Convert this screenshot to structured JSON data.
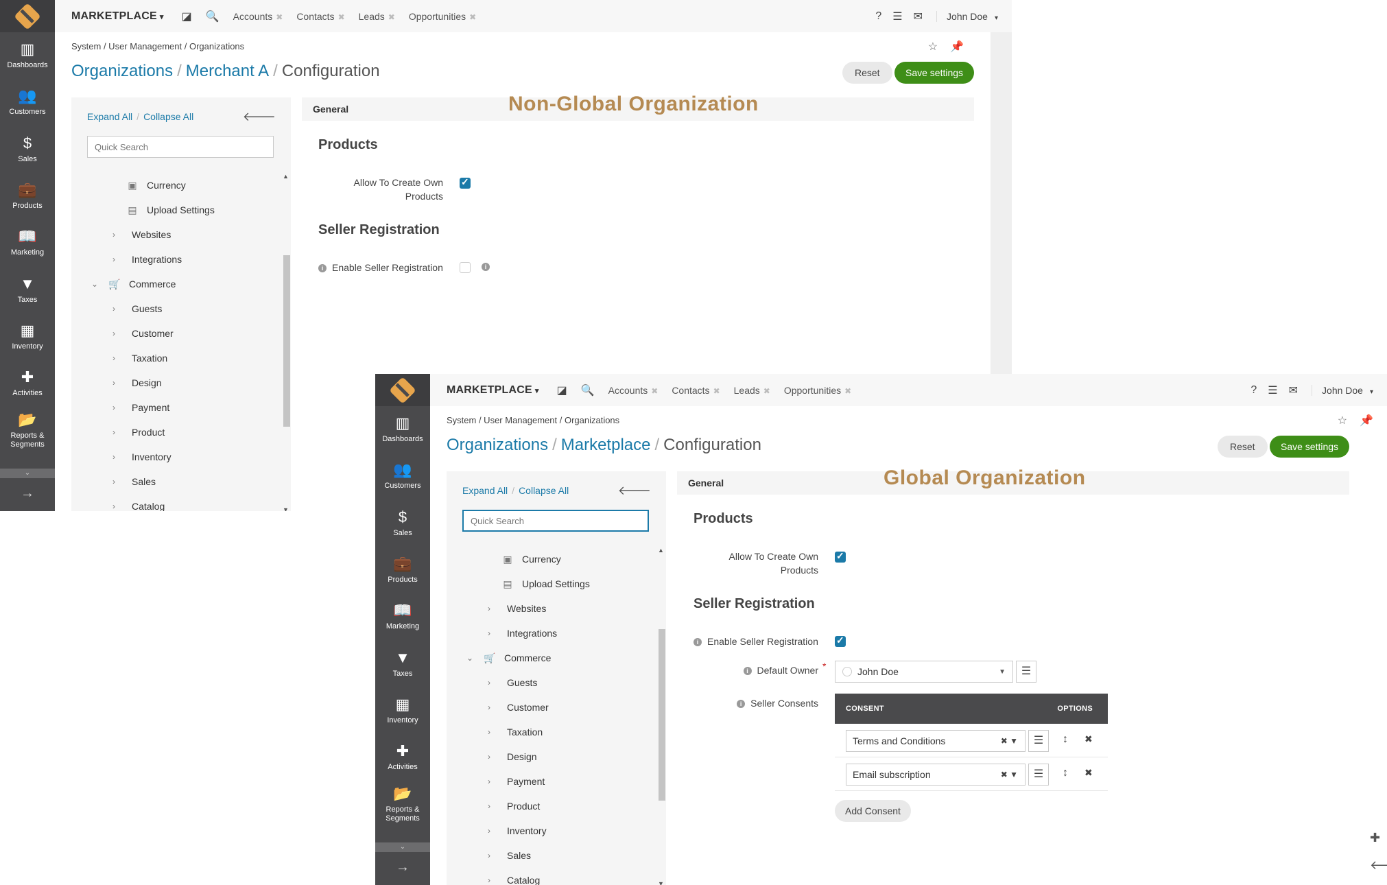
{
  "sidebar": {
    "items": [
      {
        "label": "Dashboards",
        "icon": "dashboards-icon",
        "glyph": "▥"
      },
      {
        "label": "Customers",
        "icon": "customers-icon",
        "glyph": "👥"
      },
      {
        "label": "Sales",
        "icon": "sales-icon",
        "glyph": "$"
      },
      {
        "label": "Products",
        "icon": "products-icon",
        "glyph": "💼"
      },
      {
        "label": "Marketing",
        "icon": "marketing-icon",
        "glyph": "📖"
      },
      {
        "label": "Taxes",
        "icon": "taxes-icon",
        "glyph": "▼"
      },
      {
        "label": "Inventory",
        "icon": "inventory-icon",
        "glyph": "▦"
      },
      {
        "label": "Activities",
        "icon": "activities-icon",
        "glyph": "✚"
      },
      {
        "label": "Reports & Segments",
        "icon": "reports-icon",
        "glyph": "📂"
      }
    ],
    "collapse_glyph": "⌄",
    "expand_glyph": "→"
  },
  "header": {
    "brand": "MARKETPLACE",
    "caret": "▾",
    "pinned_tabs": [
      "Accounts",
      "Contacts",
      "Leads",
      "Opportunities"
    ],
    "close_glyph": "✖",
    "user": "John Doe",
    "help_glyph": "?",
    "list_glyph": "☰",
    "mail_glyph": "✉",
    "history_glyph": "◪",
    "search_glyph": "🔍"
  },
  "breadcrumb": "System / User Management / Organizations",
  "page_icons": {
    "star": "☆",
    "pin": "📌"
  },
  "buttons": {
    "reset": "Reset",
    "save": "Save settings",
    "add_consent": "Add Consent"
  },
  "tree": {
    "expand_all": "Expand All",
    "collapse_all": "Collapse All",
    "separator": "/",
    "back_glyph": "🡐",
    "search_placeholder": "Quick Search",
    "items": [
      {
        "label": "Currency",
        "glyph": "▣",
        "level": 2
      },
      {
        "label": "Upload Settings",
        "glyph": "▤",
        "level": 2
      },
      {
        "label": "Websites",
        "glyph": "›",
        "level": 1
      },
      {
        "label": "Integrations",
        "glyph": "›",
        "level": 1
      },
      {
        "label": "Commerce",
        "glyph": "⌄",
        "level": 0,
        "cart": "🛒"
      },
      {
        "label": "Guests",
        "glyph": "›",
        "level": 1
      },
      {
        "label": "Customer",
        "glyph": "›",
        "level": 1
      },
      {
        "label": "Taxation",
        "glyph": "›",
        "level": 1
      },
      {
        "label": "Design",
        "glyph": "›",
        "level": 1
      },
      {
        "label": "Payment",
        "glyph": "›",
        "level": 1
      },
      {
        "label": "Product",
        "glyph": "›",
        "level": 1
      },
      {
        "label": "Inventory",
        "glyph": "›",
        "level": 1
      },
      {
        "label": "Sales",
        "glyph": "›",
        "level": 1
      },
      {
        "label": "Catalog",
        "glyph": "›",
        "level": 1
      }
    ]
  },
  "section": {
    "bar_label": "General",
    "products_heading": "Products",
    "allow_label_1": "Allow To Create Own",
    "allow_label_2": "Products",
    "seller_heading": "Seller Registration",
    "enable_label": "Enable Seller Registration",
    "owner_label": "Default Owner",
    "required_mark": "*",
    "consents_label": "Seller Consents"
  },
  "screens": [
    {
      "title_org": "Organizations",
      "title_entity": "Merchant A",
      "title_page": "Configuration",
      "title_sep": "/",
      "watermark": "Non-Global Organization",
      "allow_checked": true,
      "enable_checked": false
    },
    {
      "title_org": "Organizations",
      "title_entity": "Marketplace",
      "title_page": "Configuration",
      "title_sep": "/",
      "watermark": "Global Organization",
      "allow_checked": true,
      "enable_checked": true,
      "owner_value": "John Doe",
      "consent_head": "CONSENT",
      "options_head": "OPTIONS",
      "consents": [
        "Terms and Conditions",
        "Email subscription"
      ]
    }
  ],
  "colors": {
    "accent": "#1b7aa8",
    "save_green": "#3e8e17",
    "sidebar": "#4a4a4c",
    "watermark": "#b58a52"
  }
}
